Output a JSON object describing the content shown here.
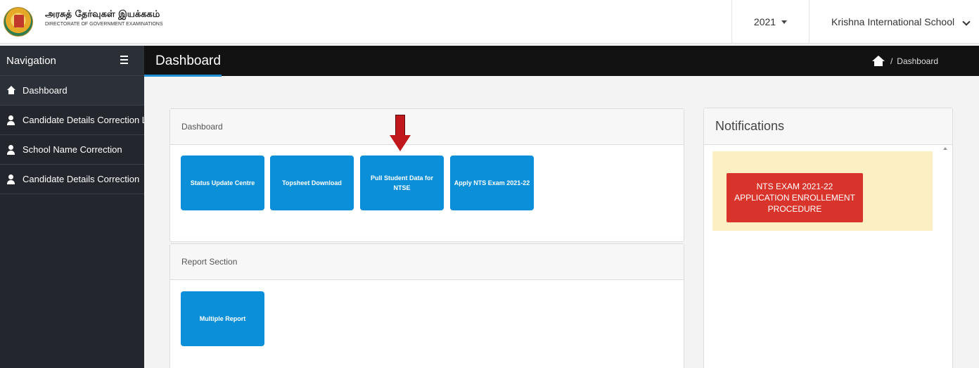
{
  "brand": {
    "title_tamil": "அரசுத் தேர்வுகள் இயக்ககம்",
    "subtitle": "DIRECTORATE OF GOVERNMENT EXAMINATIONS"
  },
  "topbar": {
    "year": "2021",
    "school": "Krishna International School"
  },
  "sidebar": {
    "heading": "Navigation",
    "items": [
      {
        "label": "Dashboard",
        "icon": "home-icon"
      },
      {
        "label": "Candidate Details Correction List",
        "icon": "user-icon"
      },
      {
        "label": "School Name Correction",
        "icon": "user-icon"
      },
      {
        "label": "Candidate Details Correction",
        "icon": "user-icon"
      }
    ]
  },
  "header": {
    "title": "Dashboard",
    "breadcrumb_sep": "/",
    "breadcrumb_current": "Dashboard"
  },
  "dashboard_panel": {
    "heading": "Dashboard",
    "tiles": [
      "Status Update Centre",
      "Topsheet Download",
      "Pull Student Data for NTSE",
      "Apply NTS Exam 2021-22"
    ]
  },
  "report_panel": {
    "heading": "Report Section",
    "tiles": [
      "Multiple Report"
    ]
  },
  "notifications": {
    "heading": "Notifications",
    "items": [
      "NTS EXAM 2021-22 APPLICATION ENROLLEMENT PROCEDURE"
    ]
  },
  "colors": {
    "tile": "#0b8fd8",
    "sidebar": "#23262d",
    "header": "#121212",
    "notification_button": "#d8342b",
    "notification_bg": "#fcefc4",
    "annotation_arrow": "#c0181c"
  }
}
